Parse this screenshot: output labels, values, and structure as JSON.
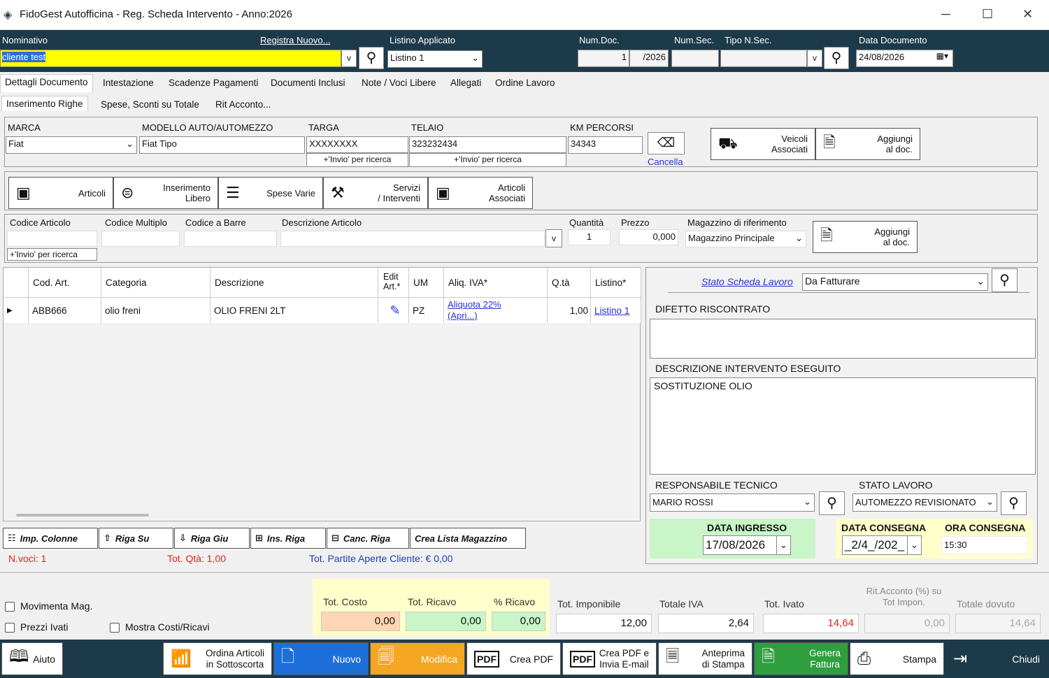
{
  "window": {
    "title": "FidoGest Autofficina - Reg. Scheda Intervento - Anno:2026",
    "min": "─",
    "max": "☐",
    "close": "✕"
  },
  "header": {
    "nominativo_label": "Nominativo",
    "registra_link": "Registra Nuovo...",
    "nominativo_value": "cliente test",
    "dropdown_v": "v",
    "listino_label": "Listino Applicato",
    "listino_value": "Listino 1",
    "numdoc_label": "Num.Doc.",
    "numdoc_value": "1",
    "numdoc_suffix": "/2026",
    "numsec_label": "Num.Sec.",
    "tiponsec_label": "Tipo N.Sec.",
    "data_label": "Data Documento",
    "data_value": "24/08/2026"
  },
  "tabs": [
    "Dettagli Documento",
    "Intestazione",
    "Scadenze Pagamenti",
    "Documenti Inclusi",
    "Note / Voci Libere",
    "Allegati",
    "Ordine Lavoro"
  ],
  "subtabs": [
    "Inserimento Righe",
    "Spese, Sconti su Totale",
    "Rit Acconto..."
  ],
  "vehicle": {
    "marca_label": "MARCA",
    "marca_value": "Fiat",
    "modello_label": "MODELLO AUTO/AUTOMEZZO",
    "modello_value": "Fiat Tipo",
    "targa_label": "TARGA",
    "targa_value": "XXXXXXXX",
    "targa_hint": "+'Invio' per ricerca",
    "telaio_label": "TELAIO",
    "telaio_value": "323232434",
    "telaio_hint": "+'Invio' per ricerca",
    "km_label": "KM PERCORSI",
    "km_value": "34343",
    "cancella_label": "Cancella",
    "veicoli_label": "Veicoli\nAssociati",
    "aggiungi_label": "Aggiungi\nal doc."
  },
  "itemButtons": [
    {
      "label": "Articoli",
      "icon": "box-icon"
    },
    {
      "label": "Inserimento\nLibero",
      "icon": "filter-icon"
    },
    {
      "label": "Spese Varie",
      "icon": "list-icon"
    },
    {
      "label": "Servizi\n/ Interventi",
      "icon": "tools-icon"
    },
    {
      "label": "Articoli\nAssociati",
      "icon": "box-icon"
    }
  ],
  "search": {
    "codice_label": "Codice Articolo",
    "multiplo_label": "Codice Multiplo",
    "barre_label": "Codice a Barre",
    "descr_label": "Descrizione Articolo",
    "qta_label": "Quantità",
    "qta_value": "1",
    "prezzo_label": "Prezzo",
    "prezzo_value": "0,000",
    "mag_label": "Magazzino di riferimento",
    "mag_value": "Magazzino Principale",
    "hint": "+'Invio' per ricerca",
    "aggiungi_label": "Aggiungi\nal doc."
  },
  "table": {
    "headers": [
      "Cod. Art.",
      "Categoria",
      "Descrizione",
      "Edit Art.*",
      "UM",
      "Aliq. IVA*",
      "Q.tà",
      "Listino*"
    ],
    "rows": [
      {
        "cod": "ABB666",
        "cat": "olio freni",
        "descr": "OLIO FRENI 2LT",
        "um": "PZ",
        "iva": "Aliquota 22% (Apri...)",
        "qta": "1,00",
        "listino": "Listino 1"
      }
    ]
  },
  "grid_buttons": [
    "Imp. Colonne",
    "Riga Su",
    "Riga Giu",
    "Ins. Riga",
    "Canc. Riga",
    "Crea Lista Magazzino"
  ],
  "status": {
    "nvoci": "N.voci: 1",
    "totqta": "Tot. Qtà: 1,00",
    "partite": "Tot. Partite Aperte Cliente: € 0,00"
  },
  "right": {
    "stato_link": "Stato Scheda Lavoro",
    "stato_value": "Da Fatturare",
    "difetto_label": "DIFETTO RISCONTRATO",
    "descr_label": "DESCRIZIONE INTERVENTO ESEGUITO",
    "descr_value": "SOSTITUZIONE OLIO",
    "resp_label": "RESPONSABILE TECNICO",
    "resp_value": "MARIO ROSSI",
    "statolav_label": "STATO LAVORO",
    "statolav_value": "AUTOMEZZO REVISIONATO",
    "ingresso_label": "DATA INGRESSO",
    "ingresso_value": "17/08/2026",
    "consegna_label": "DATA CONSEGNA",
    "consegna_value": "_2/4_/202_",
    "ora_label": "ORA CONSEGNA",
    "ora_value": "15:30"
  },
  "totals": {
    "movimenta": "Movimenta Mag.",
    "prezzi_ivati": "Prezzi Ivati",
    "mostra": "Mostra Costi/Ricavi",
    "costo_label": "Tot. Costo",
    "costo": "0,00",
    "ricavo_label": "Tot. Ricavo",
    "ricavo": "0,00",
    "perc_label": "% Ricavo",
    "perc": "0,00",
    "impon_label": "Tot. Imponibile",
    "impon": "12,00",
    "iva_label": "Totale IVA",
    "iva": "2,64",
    "ivato_label": "Tot. Ivato",
    "ivato": "14,64",
    "rit_label": "Rit.Acconto (%) su\nTot Impon.",
    "rit": "0,00",
    "dovuto_label": "Totale dovuto",
    "dovuto": "14,64"
  },
  "footer": [
    {
      "label": "Aiuto",
      "icon": "book-icon"
    },
    {
      "label": "Ordina Articoli\nin Sottoscorta",
      "icon": "chart-icon"
    },
    {
      "label": "Nuovo",
      "icon": "new-doc-icon"
    },
    {
      "label": "Modifica",
      "icon": "edit-doc-icon"
    },
    {
      "label": "Crea PDF",
      "icon": "pdf-icon"
    },
    {
      "label": "Crea PDF e\nInvia E-mail",
      "icon": "pdf-mail-icon"
    },
    {
      "label": "Anteprima\ndi Stampa",
      "icon": "preview-icon"
    },
    {
      "label": "Genera\nFattura",
      "icon": "invoice-icon"
    },
    {
      "label": "Stampa",
      "icon": "printer-icon"
    },
    {
      "label": "Chiudi",
      "icon": "exit-icon"
    }
  ],
  "colors": {
    "header": "#1d3a4a",
    "yellow": "#ffff00",
    "blue_btn": "#1e6fd9",
    "orange_btn": "#f5a623",
    "green_btn": "#2e9e3e",
    "green_area": "#c9f5c9",
    "yellow_area": "#ffffcc"
  }
}
